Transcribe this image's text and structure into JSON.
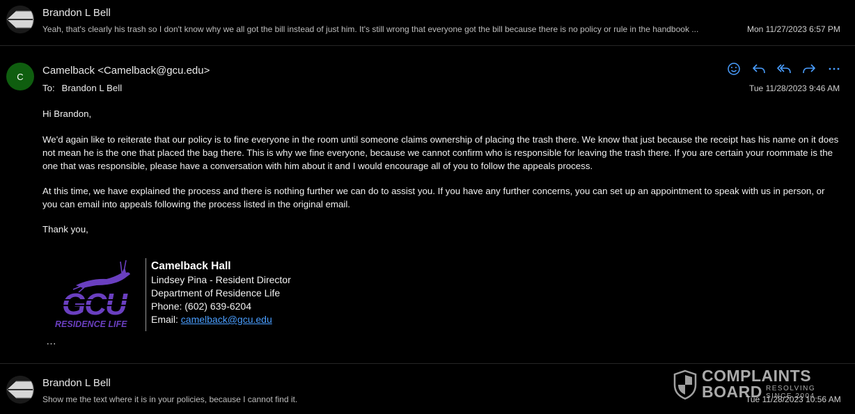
{
  "thread": [
    {
      "sender": "Brandon L Bell",
      "snippet": "Yeah, that's clearly his trash so I don't know why we all got the bill instead of just him. It's still wrong that everyone got the bill because there is no policy or rule in the handbook ...",
      "date": "Mon 11/27/2023 6:57 PM"
    },
    {
      "sender": "Brandon L Bell",
      "snippet": "Show me the text where it is in your policies, because I cannot find it.",
      "date": "Tue 11/28/2023 10:56 AM"
    }
  ],
  "open_message": {
    "avatar_initial": "C",
    "avatar_color": "#0f5e0f",
    "from": "Camelback <Camelback@gcu.edu>",
    "to_label": "To:",
    "to": "Brandon L Bell",
    "date": "Tue 11/28/2023 9:46 AM",
    "greeting": "Hi Brandon,",
    "paragraph1": "We'd again like to reiterate that our policy is to fine everyone in the room until someone claims ownership of placing the trash there. We know that just because the receipt has his name on it does not mean he is the one that placed the bag there. This is why we fine everyone, because we cannot confirm who is responsible for leaving the trash there. If you are certain your roommate is the one that was responsible, please have a conversation with him about it and I would encourage all of you to follow the appeals process.",
    "paragraph2": "At this time, we have explained the process and there is nothing further we can do to assist you. If you have any further concerns, you can set up an appointment to speak with us in person, or you can email into appeals following the process listed in the original email.",
    "closing": "Thank you,",
    "more": "…"
  },
  "actions": {
    "emoji_icon": "smiley-icon",
    "reply_icon": "reply-icon",
    "reply_all_icon": "reply-all-icon",
    "forward_icon": "forward-icon",
    "more_icon": "more-icon",
    "accent": "#4a9eff"
  },
  "signature": {
    "title": "Camelback Hall",
    "line1": "Lindsey Pina - Resident Director",
    "line2": "Department of Residence Life",
    "line3": "Phone: (602) 639-6204",
    "email_label": "Email: ",
    "email": "camelback@gcu.edu",
    "logo_text": "GCU",
    "logo_subtext": "RESIDENCE LIFE",
    "logo_color": "#6a3fc0"
  },
  "watermark": {
    "line1": "COMPLAINTS",
    "line2": "BOARD",
    "tag1": "RESOLVING",
    "tag2": "SINCE 2004"
  }
}
